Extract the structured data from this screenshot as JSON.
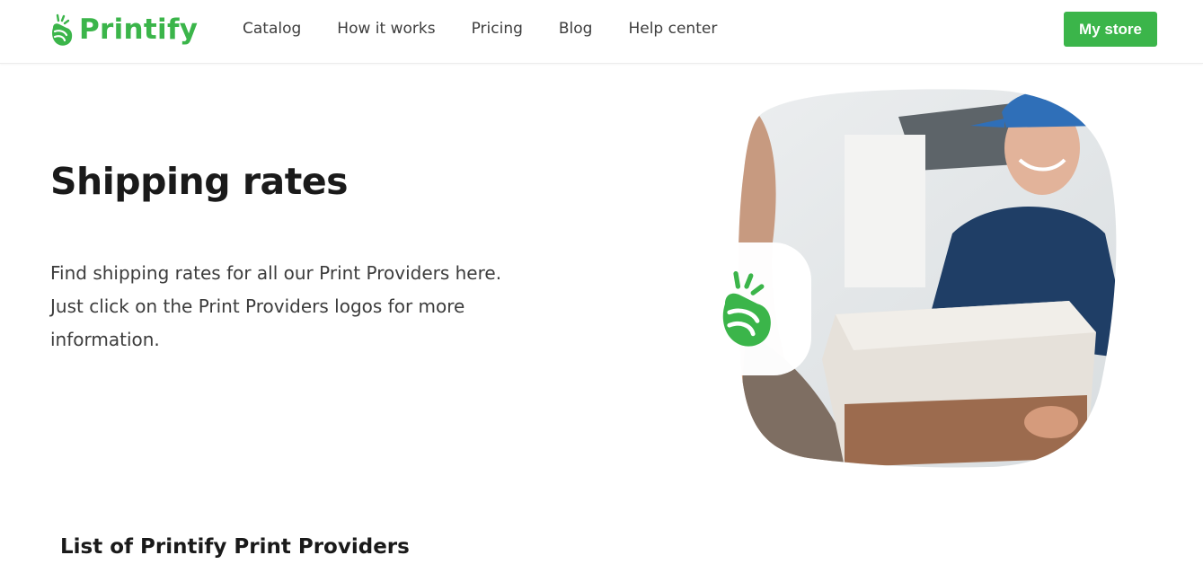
{
  "brand": {
    "name": "Printify",
    "color": "#3bb54a"
  },
  "nav": {
    "items": [
      {
        "label": "Catalog"
      },
      {
        "label": "How it works"
      },
      {
        "label": "Pricing"
      },
      {
        "label": "Blog"
      },
      {
        "label": "Help center"
      }
    ],
    "cta_label": "My store"
  },
  "hero": {
    "title": "Shipping rates",
    "description": "Find shipping rates for all our Print Providers here. Just click on the Print Providers logos for more information.",
    "image_icon": "delivery-photo"
  },
  "section": {
    "title": "List of Printify Print Providers"
  }
}
